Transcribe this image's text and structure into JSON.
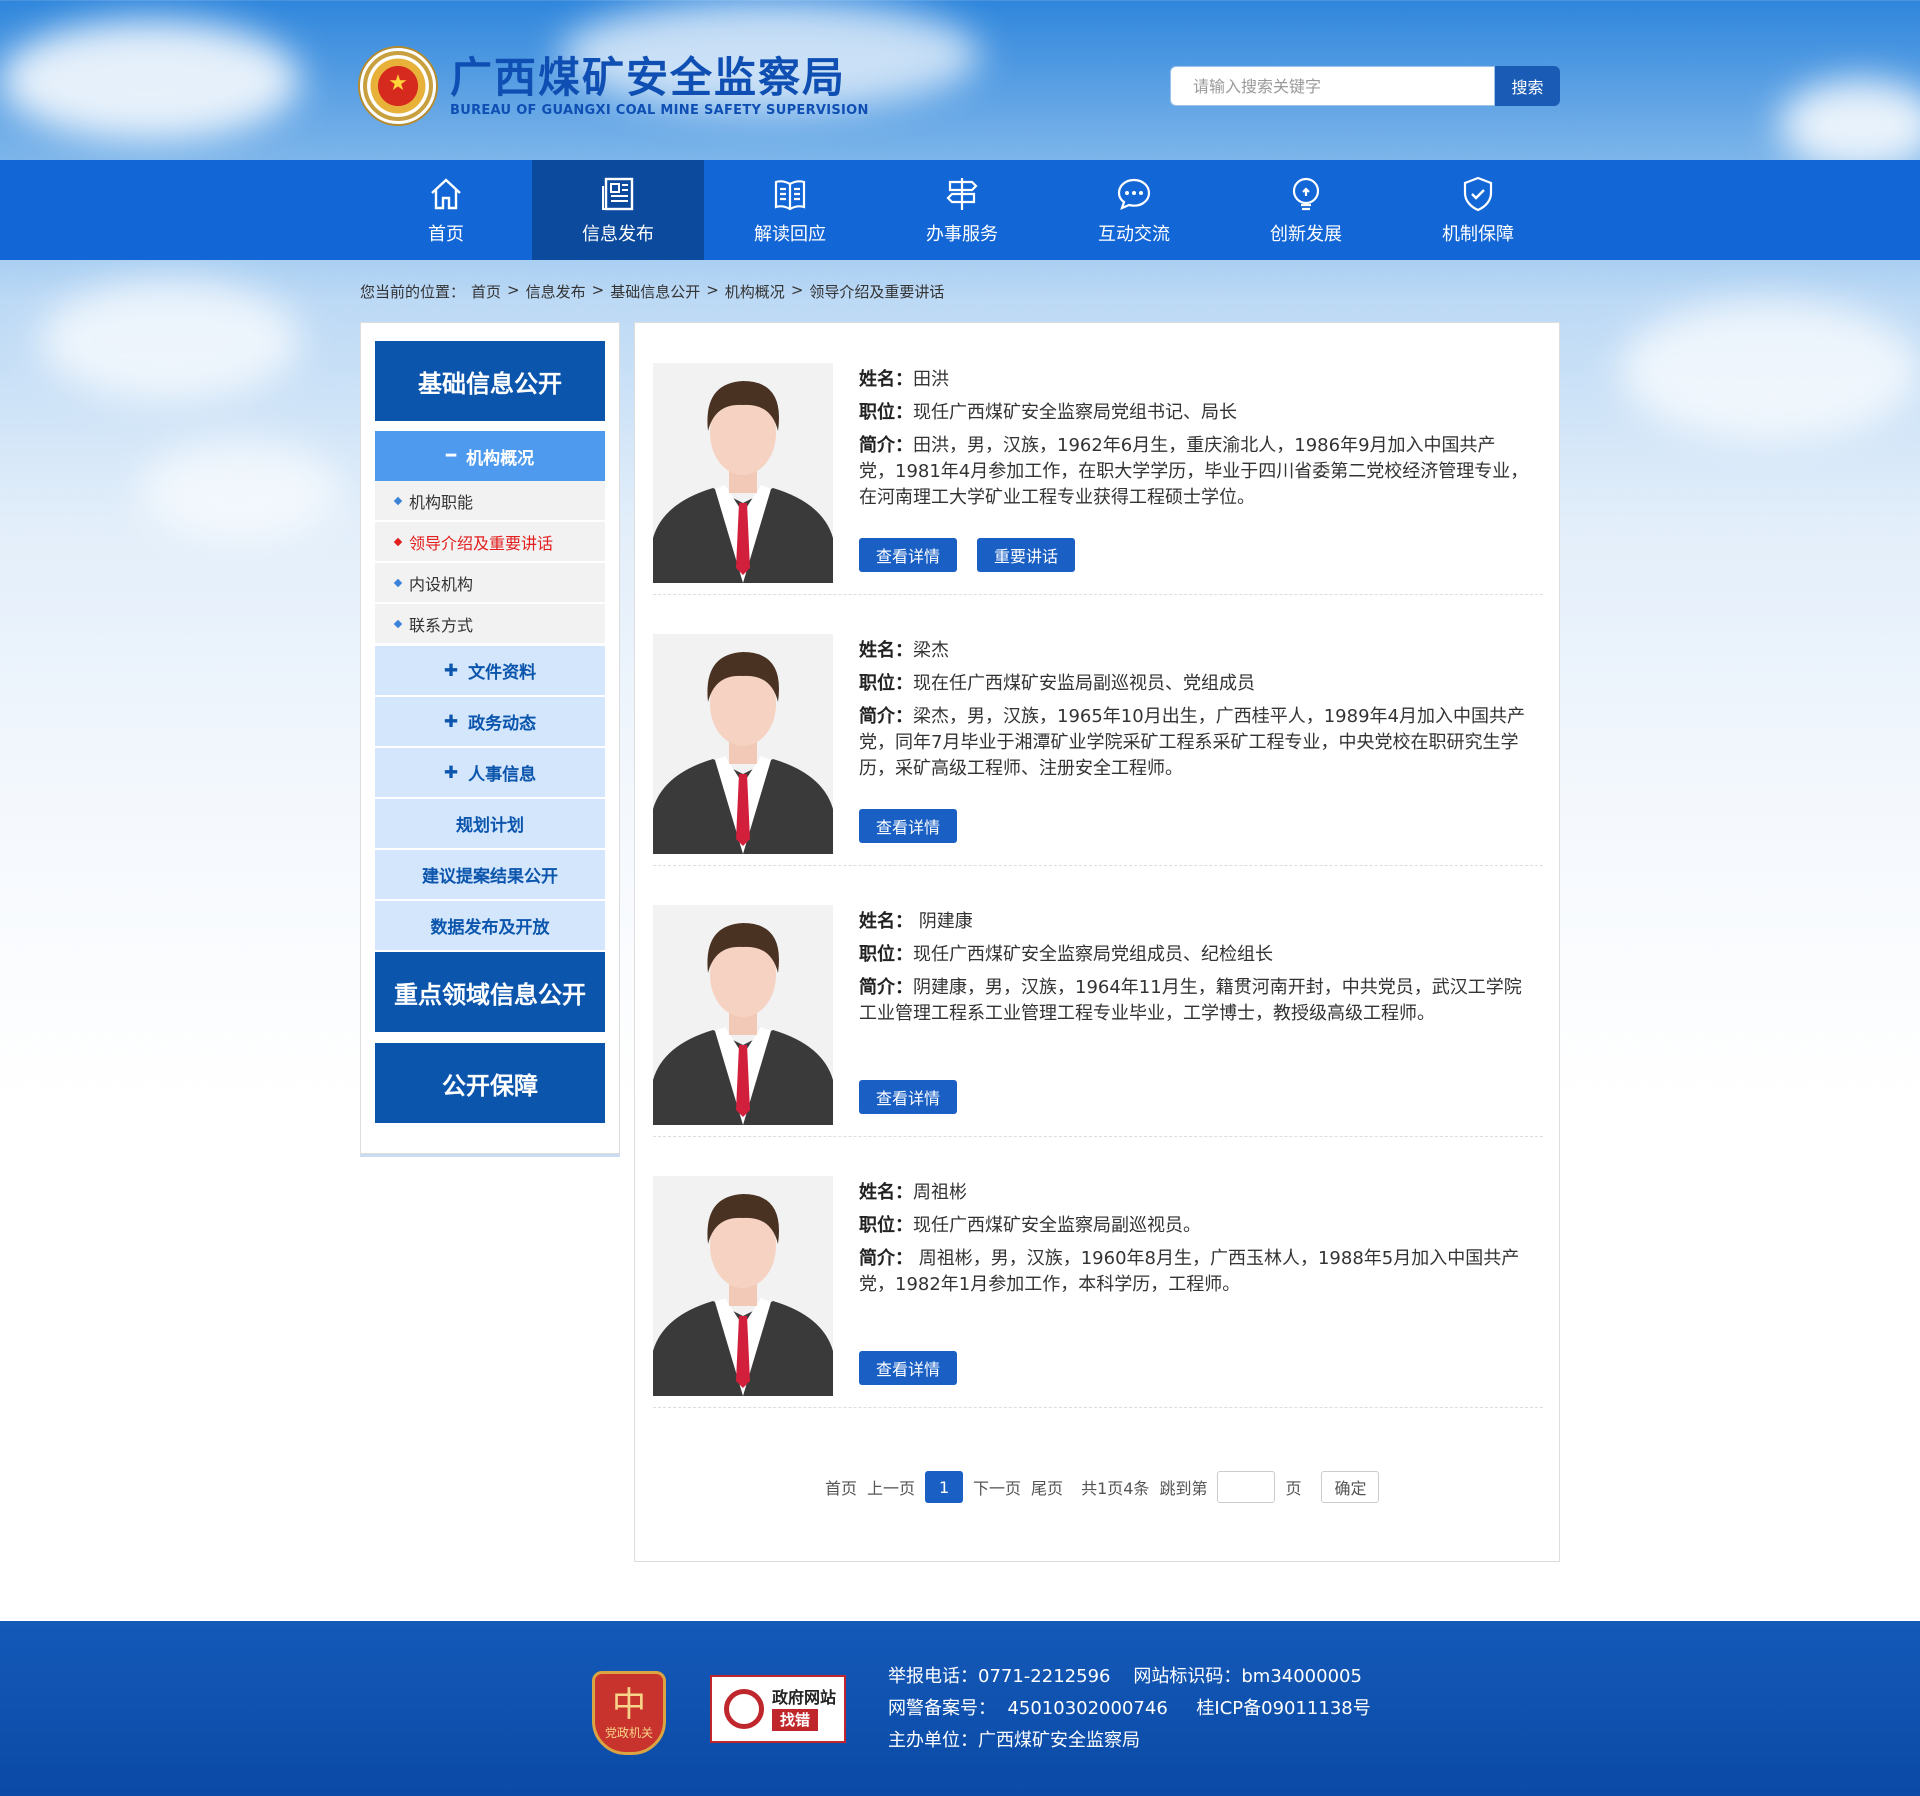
{
  "site": {
    "title_cn": "广西煤矿安全监察局",
    "title_en": "BUREAU OF GUANGXI COAL MINE SAFETY SUPERVISION"
  },
  "search": {
    "placeholder": "请输入搜索关键字",
    "button": "搜索"
  },
  "nav": {
    "items": [
      {
        "label": "首页",
        "icon": "home-icon"
      },
      {
        "label": "信息发布",
        "icon": "newspaper-icon"
      },
      {
        "label": "解读回应",
        "icon": "book-icon"
      },
      {
        "label": "办事服务",
        "icon": "signpost-icon"
      },
      {
        "label": "互动交流",
        "icon": "chat-icon"
      },
      {
        "label": "创新发展",
        "icon": "lightbulb-icon"
      },
      {
        "label": "机制保障",
        "icon": "shield-check-icon"
      }
    ],
    "active": 1
  },
  "breadcrumb": {
    "prefix": "您当前的位置：",
    "items": [
      "首页",
      "信息发布",
      "基础信息公开",
      "机构概况",
      "领导介绍及重要讲话"
    ]
  },
  "sidebar": {
    "section1": "基础信息公开",
    "expanded": "机构概况",
    "leaves": [
      "机构职能",
      "领导介绍及重要讲话",
      "内设机构",
      "联系方式"
    ],
    "categories_plus": [
      "文件资料",
      "政务动态",
      "人事信息"
    ],
    "categories_plain": [
      "规划计划",
      "建议提案结果公开",
      "数据发布及开放"
    ],
    "section2": "重点领域信息公开",
    "section3": "公开保障"
  },
  "labels": {
    "name": "姓名：",
    "position": "职位：",
    "intro": "简介："
  },
  "leaders": [
    {
      "name": "田洪",
      "position": "现任广西煤矿安全监察局党组书记、局长",
      "intro": "田洪，男，汉族，1962年6月生，重庆渝北人，1986年9月加入中国共产党，1981年4月参加工作，在职大学学历，毕业于四川省委第二党校经济管理专业，在河南理工大学矿业工程专业获得工程硕士学位。",
      "buttons": [
        "查看详情",
        "重要讲话"
      ]
    },
    {
      "name": "梁杰",
      "position": "现在任广西煤矿安监局副巡视员、党组成员",
      "intro": "梁杰，男，汉族，1965年10月出生，广西桂平人，1989年4月加入中国共产党，同年7月毕业于湘潭矿业学院采矿工程系采矿工程专业，中央党校在职研究生学历，采矿高级工程师、注册安全工程师。",
      "buttons": [
        "查看详情"
      ]
    },
    {
      "name": " 阴建康",
      "position": "现任广西煤矿安全监察局党组成员、纪检组长",
      "intro": "阴建康，男，汉族，1964年11月生，籍贯河南开封，中共党员，武汉工学院工业管理工程系工业管理工程专业毕业，工学博士，教授级高级工程师。",
      "buttons": [
        "查看详情"
      ]
    },
    {
      "name": "周祖彬",
      "position": "现任广西煤矿安全监察局副巡视员。",
      "intro": " 周祖彬，男，汉族，1960年8月生，广西玉林人，1988年5月加入中国共产党，1982年1月参加工作，本科学历，工程师。",
      "buttons": [
        "查看详情"
      ]
    }
  ],
  "pager": {
    "first": "首页",
    "prev": "上一页",
    "current": "1",
    "next": "下一页",
    "last": "尾页",
    "summary": "共1页4条",
    "jump_prefix": "跳到第",
    "jump_suffix": "页",
    "confirm": "确定"
  },
  "footer": {
    "badge_party": "党政机关",
    "badge_error_line1": "政府网站",
    "badge_error_line2": "找错",
    "line1": "举报电话：0771-2212596    网站标识码：bm34000005",
    "line2": "网警备案号：  45010302000746     桂ICP备09011138号",
    "line3": "主办单位：广西煤矿安全监察局"
  }
}
